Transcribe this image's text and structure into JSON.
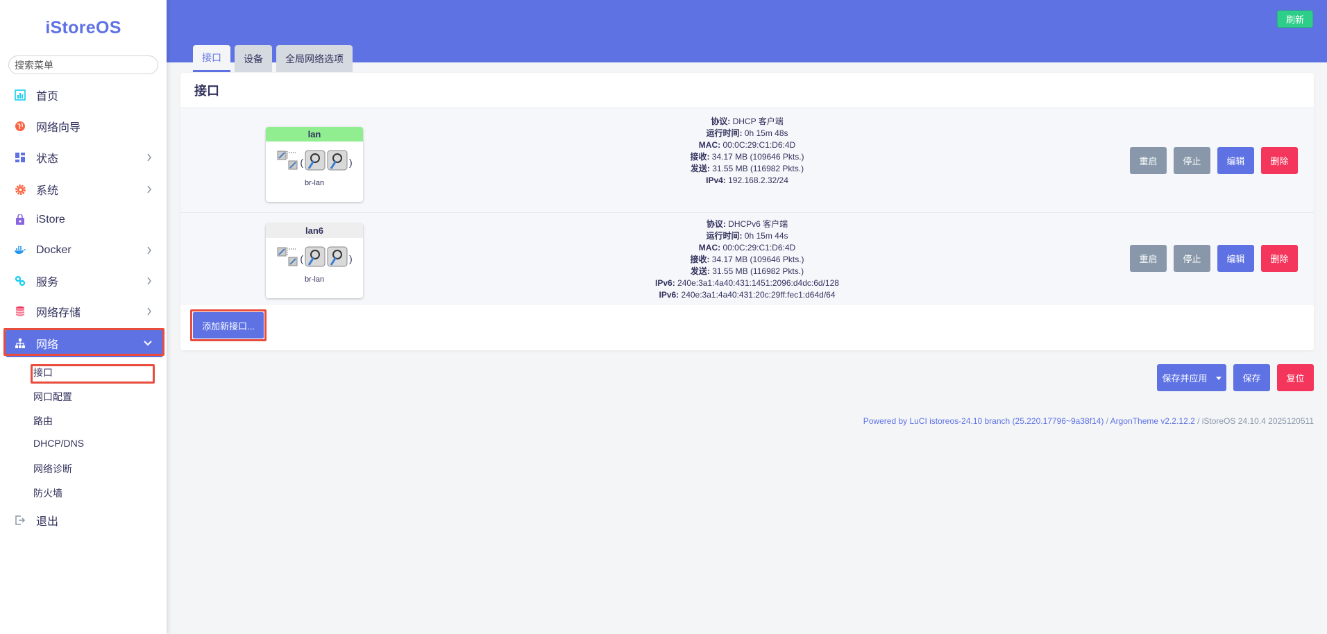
{
  "brand": "iStoreOS",
  "search": {
    "placeholder": "搜索菜单"
  },
  "sidebar": {
    "items": [
      {
        "label": "首页",
        "icon": "dashboard-icon"
      },
      {
        "label": "网络向导",
        "icon": "globe-icon"
      },
      {
        "label": "状态",
        "icon": "grid-icon"
      },
      {
        "label": "系统",
        "icon": "gear-icon"
      },
      {
        "label": "iStore",
        "icon": "bag-icon"
      },
      {
        "label": "Docker",
        "icon": "docker-icon"
      },
      {
        "label": "服务",
        "icon": "puzzle-icon"
      },
      {
        "label": "网络存储",
        "icon": "database-icon"
      },
      {
        "label": "网络",
        "icon": "network-icon"
      }
    ],
    "network_sub": [
      "接口",
      "网口配置",
      "路由",
      "DHCP/DNS",
      "网络诊断",
      "防火墙"
    ],
    "logout": "退出"
  },
  "header": {
    "refresh": "刷新"
  },
  "tabs": [
    "接口",
    "设备",
    "全局网络选项"
  ],
  "card": {
    "title": "接口"
  },
  "interfaces": [
    {
      "name": "lan",
      "device": "br-lan",
      "head_color": "#90ee90",
      "info": [
        {
          "k": "协议:",
          "v": " DHCP 客户端"
        },
        {
          "k": "运行时间:",
          "v": " 0h 15m 48s"
        },
        {
          "k": "MAC:",
          "v": " 00:0C:29:C1:D6:4D"
        },
        {
          "k": "接收:",
          "v": " 34.17 MB (109646 Pkts.)"
        },
        {
          "k": "发送:",
          "v": " 31.55 MB (116982 Pkts.)"
        },
        {
          "k": "IPv4:",
          "v": " 192.168.2.32/24"
        }
      ]
    },
    {
      "name": "lan6",
      "device": "br-lan",
      "head_color": "#eeeeee",
      "info": [
        {
          "k": "协议:",
          "v": " DHCPv6 客户端"
        },
        {
          "k": "运行时间:",
          "v": " 0h 15m 44s"
        },
        {
          "k": "MAC:",
          "v": " 00:0C:29:C1:D6:4D"
        },
        {
          "k": "接收:",
          "v": " 34.17 MB (109646 Pkts.)"
        },
        {
          "k": "发送:",
          "v": " 31.55 MB (116982 Pkts.)"
        },
        {
          "k": "IPv6:",
          "v": " 240e:3a1:4a40:431:1451:2096:d4dc:6d/128"
        },
        {
          "k": "IPv6:",
          "v": " 240e:3a1:4a40:431:20c:29ff:fec1:d64d/64"
        }
      ]
    }
  ],
  "row_buttons": {
    "restart": "重启",
    "stop": "停止",
    "edit": "编辑",
    "delete": "删除"
  },
  "add_interface": "添加新接口...",
  "footer_buttons": {
    "save_apply": "保存并应用",
    "save": "保存",
    "reset": "复位"
  },
  "powered": {
    "luci": "Powered by LuCI istoreos-24.10 branch (25.220.17796~9a38f14)",
    "sep": " / ",
    "theme": "ArgonTheme v2.2.12.2",
    "os": " / iStoreOS 24.10.4 2025120511"
  }
}
